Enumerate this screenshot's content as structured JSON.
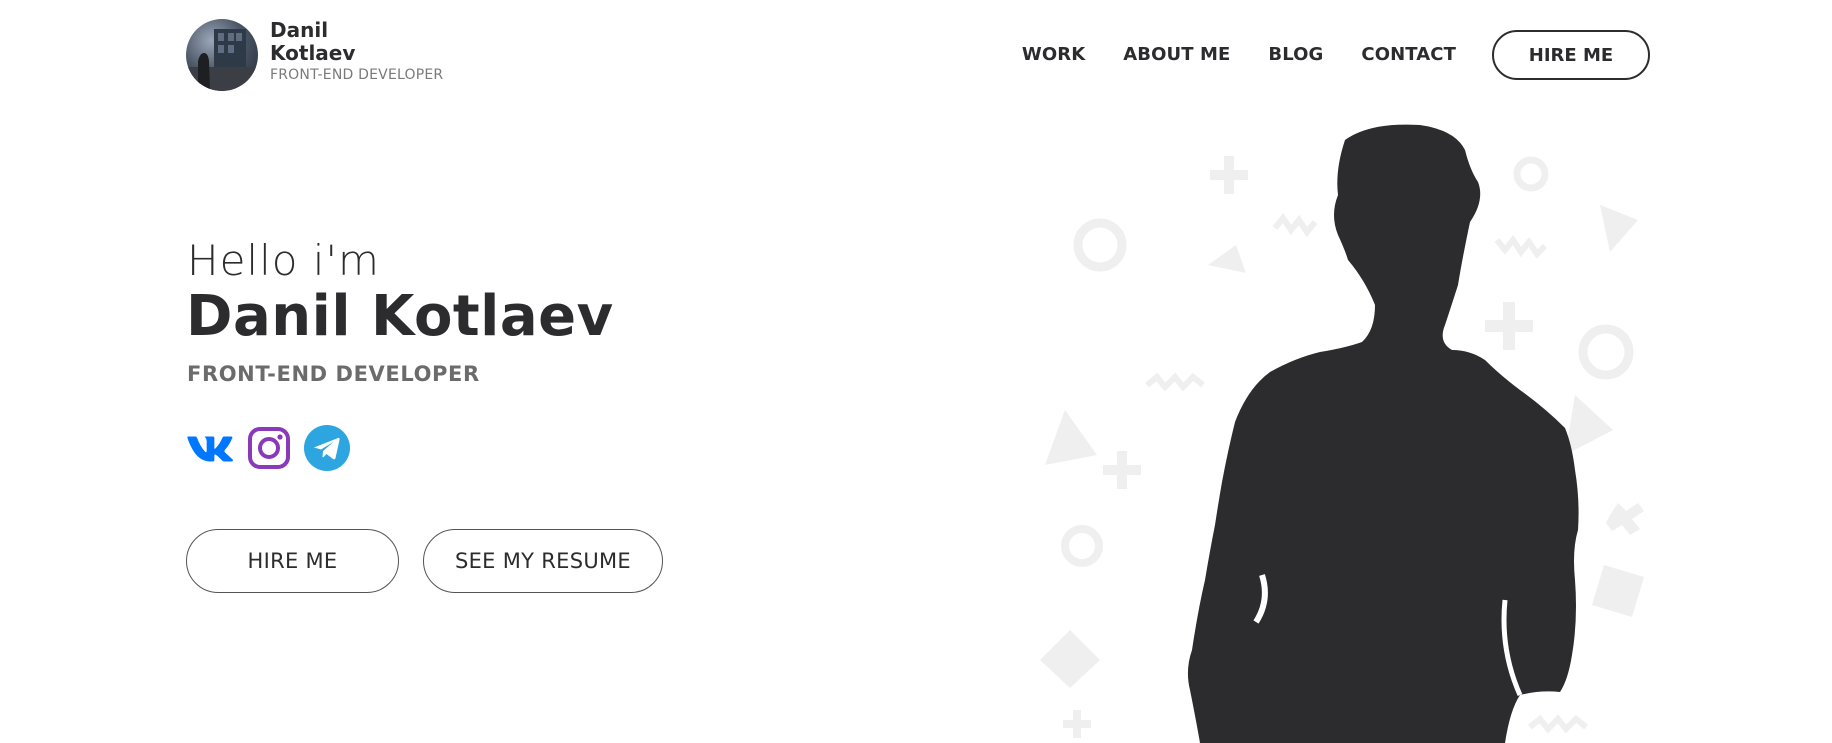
{
  "brand": {
    "name": "Danil Kotlaev",
    "role": "FRONT-END DEVELOPER"
  },
  "nav": {
    "items": [
      "WORK",
      "ABOUT ME",
      "BLOG",
      "CONTACT"
    ],
    "hire_label": "HIRE ME"
  },
  "hero": {
    "greeting": "Hello i'm",
    "name": "Danil Kotlaev",
    "role": "FRONT-END DEVELOPER"
  },
  "socials": [
    {
      "icon": "vk-icon",
      "color": "#0077ff"
    },
    {
      "icon": "instagram-icon",
      "color": "#8a3ab9"
    },
    {
      "icon": "telegram-icon",
      "color": "#2ca5e0"
    }
  ],
  "actions": {
    "hire_label": "HIRE ME",
    "resume_label": "SEE MY RESUME"
  },
  "colors": {
    "text": "#2c2c2e",
    "muted": "#6b6b6b",
    "silhouette": "#2c2c2e",
    "decor": "#efefef"
  }
}
